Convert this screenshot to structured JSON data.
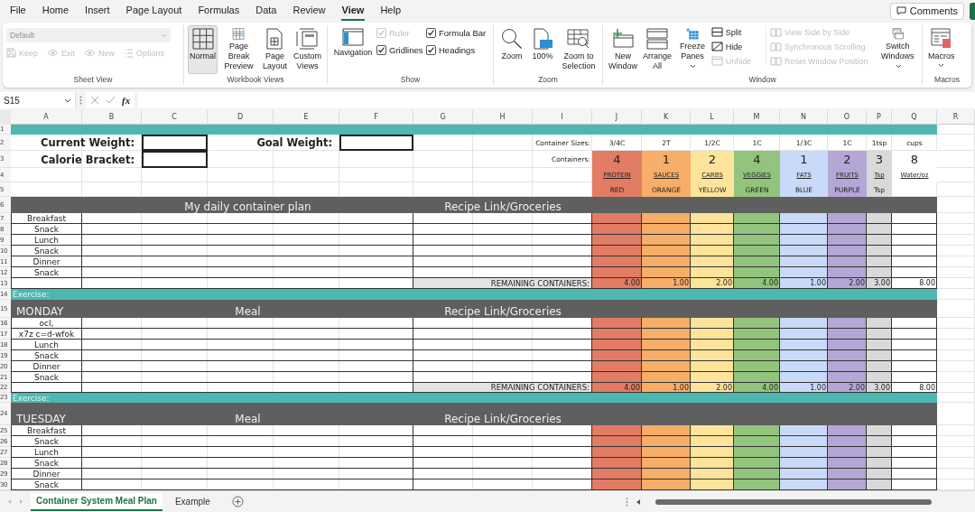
{
  "menu_tabs": [
    {
      "label": "File",
      "selected": false
    },
    {
      "label": "Home",
      "selected": false
    },
    {
      "label": "Insert",
      "selected": false
    },
    {
      "label": "Page Layout",
      "selected": false
    },
    {
      "label": "Formulas",
      "selected": false
    },
    {
      "label": "Data",
      "selected": false
    },
    {
      "label": "Review",
      "selected": false
    },
    {
      "label": "View",
      "selected": true
    },
    {
      "label": "Help",
      "selected": false
    }
  ],
  "comments_button": "Comments",
  "ribbon": {
    "sheet_view": {
      "label": "Sheet View",
      "dropdown": {
        "value": "Default",
        "disabled": true
      },
      "buttons": [
        {
          "label": "Keep",
          "disabled": true
        },
        {
          "label": "Exit",
          "disabled": true
        },
        {
          "label": "New",
          "disabled": true
        },
        {
          "label": "Options",
          "disabled": true
        }
      ]
    },
    "workbook_views": {
      "label": "Workbook Views",
      "buttons": [
        {
          "label": "Normal",
          "selected": true
        },
        {
          "label": "Page Break Preview",
          "selected": false
        },
        {
          "label": "Page Layout",
          "selected": false
        },
        {
          "label": "Custom Views",
          "selected": false
        }
      ]
    },
    "show": {
      "label": "Show",
      "navigation": "Navigation",
      "checkboxes": [
        {
          "label": "Ruler",
          "checked": true,
          "disabled": true
        },
        {
          "label": "Formula Bar",
          "checked": true,
          "disabled": false
        },
        {
          "label": "Gridlines",
          "checked": true,
          "disabled": false
        },
        {
          "label": "Headings",
          "checked": true,
          "disabled": false
        }
      ]
    },
    "zoom": {
      "label": "Zoom",
      "buttons": [
        "Zoom",
        "100%",
        "Zoom to Selection"
      ]
    },
    "window": {
      "label": "Window",
      "large_buttons": [
        "New Window",
        "Arrange All",
        "Freeze Panes"
      ],
      "small_buttons": [
        {
          "label": "Split",
          "disabled": false
        },
        {
          "label": "Hide",
          "disabled": false
        },
        {
          "label": "Unhide",
          "disabled": true
        }
      ],
      "side_buttons": [
        {
          "label": "View Side by Side",
          "disabled": true
        },
        {
          "label": "Synchronous Scrolling",
          "disabled": true
        },
        {
          "label": "Reset Window Position",
          "disabled": true
        }
      ],
      "switch_button": "Switch Windows"
    },
    "macros": {
      "label": "Macros",
      "button": "Macros"
    }
  },
  "formula_bar": {
    "name_box": "S15",
    "function_label": "fx"
  },
  "sheet": {
    "columns": [
      "A",
      "B",
      "C",
      "D",
      "E",
      "F",
      "G",
      "H",
      "I",
      "J",
      "K",
      "L",
      "M",
      "N",
      "O",
      "P",
      "Q",
      "R"
    ],
    "rows": [
      "1",
      "2",
      "3",
      "4",
      "5",
      "6",
      "7",
      "8",
      "9",
      "10",
      "11",
      "12",
      "13",
      "14",
      "15",
      "16",
      "17",
      "18",
      "19",
      "20",
      "21",
      "22",
      "23",
      "24",
      "25",
      "26",
      "27",
      "28",
      "29",
      "30"
    ],
    "top": {
      "current_weight_label": "Current Weight:",
      "calorie_bracket_label": "Calorie Bracket:",
      "goal_weight_label": "Goal Weight:",
      "container_sizes_label": "Container Sizes:",
      "containers_label": "Containers:"
    },
    "containers": [
      {
        "size": "3/4C",
        "count": "4",
        "name": "PROTEIN",
        "color_name": "RED",
        "color": "#e27c64"
      },
      {
        "size": "2T",
        "count": "1",
        "name": "SAUCES",
        "color_name": "ORANGE",
        "color": "#f6ae68"
      },
      {
        "size": "1/2C",
        "count": "2",
        "name": "CARBS",
        "color_name": "YELLOW",
        "color": "#fee49a"
      },
      {
        "size": "1C",
        "count": "4",
        "name": "VEGGIES",
        "color_name": "GREEN",
        "color": "#93c47d"
      },
      {
        "size": "1/3C",
        "count": "1",
        "name": "FATS",
        "color_name": "BLUE",
        "color": "#c9daf8"
      },
      {
        "size": "1C",
        "count": "2",
        "name": "FRUITS",
        "color_name": "PURPLE",
        "color": "#b4a7d6"
      },
      {
        "size": "1tsp",
        "count": "3",
        "name": "Tsp",
        "color_name": "Tsp",
        "color": "#d9d9d9"
      },
      {
        "size": "cups",
        "count": "8",
        "name": "Water/oz",
        "color": "#ffffff"
      }
    ],
    "sections": [
      {
        "meal_header": "My daily container plan",
        "recipe_header": "Recipe Link/Groceries",
        "meals": [
          "Breakfast",
          "Snack",
          "Lunch",
          "Snack",
          "Dinner",
          "Snack"
        ],
        "remaining_label": "REMAINING CONTAINERS:",
        "remaining": [
          "4.00",
          "1.00",
          "2.00",
          "4.00",
          "1.00",
          "2.00",
          "3.00",
          "8.00"
        ],
        "exercise_label": "Exercise:"
      },
      {
        "day": "MONDAY",
        "meal_header": "Meal",
        "recipe_header": "Recipe Link/Groceries",
        "meals": [
          "ocl,",
          "x7z c=d-wfok",
          "Lunch",
          "Snack",
          "Dinner",
          "Snack"
        ],
        "remaining_label": "REMAINING CONTAINERS:",
        "remaining": [
          "4.00",
          "1.00",
          "2.00",
          "4.00",
          "1.00",
          "2.00",
          "3.00",
          "8.00"
        ],
        "exercise_label": "Exercise:"
      },
      {
        "day": "TUESDAY",
        "meal_header": "Meal",
        "recipe_header": "Recipe Link/Groceries",
        "meals": [
          "Breakfast",
          "Snack",
          "Lunch",
          "Snack",
          "Dinner",
          "Snack"
        ]
      }
    ]
  },
  "sheet_tabs": [
    {
      "label": "Container System Meal Plan",
      "selected": true
    },
    {
      "label": "Example",
      "selected": false
    }
  ]
}
